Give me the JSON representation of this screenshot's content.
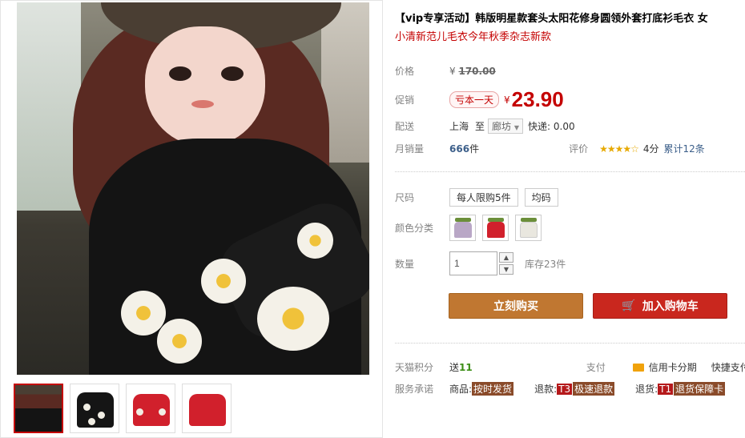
{
  "product": {
    "title": "【vip专享活动】韩版明星款套头太阳花修身圆领外套打底衫毛衣 女",
    "subtitle": "小清新范儿毛衣今年秋季杂志新款"
  },
  "price": {
    "label": "价格",
    "currency": "¥",
    "original": "170.00"
  },
  "promo": {
    "label": "促销",
    "badge": "亏本一天",
    "currency": "¥",
    "price": "23.90"
  },
  "shipping": {
    "label": "配送",
    "from": "上海",
    "to_word": "至",
    "destination": "廊坊",
    "express": "快递: 0.00"
  },
  "sales": {
    "label": "月销量",
    "count": "666",
    "unit": "件",
    "rating_label": "评价",
    "stars": "★★★★☆",
    "score": "4分",
    "reviews": "累计12条"
  },
  "size": {
    "label": "尺码",
    "options": [
      "每人限购5件",
      "均码"
    ]
  },
  "color": {
    "label": "颜色分类",
    "swatches": [
      {
        "name": "lilac",
        "color": "#b9a7c6"
      },
      {
        "name": "red",
        "color": "#d1202c"
      },
      {
        "name": "white",
        "color": "#e9e7df"
      }
    ]
  },
  "quantity": {
    "label": "数量",
    "value": "1",
    "stock": "库存23件"
  },
  "buttons": {
    "buy": "立刻购买",
    "cart": "加入购物车"
  },
  "points": {
    "label": "天猫积分",
    "prefix": "送",
    "value": "11",
    "pay_label": "支付",
    "installment": "信用卡分期",
    "fast_pay": "快捷支付"
  },
  "service": {
    "label": "服务承诺",
    "goods_prefix": "商品:",
    "goods_tag": "按时发货",
    "refund_prefix": "退款:",
    "refund_code": "T3",
    "refund_tag": "极速退款",
    "return_prefix": "退货:",
    "return_code": "T1",
    "return_tag": "退货保障卡"
  },
  "colors": {
    "accent_red": "#c40000",
    "buy_button": "#c07731",
    "cart_button": "#c9271e"
  }
}
